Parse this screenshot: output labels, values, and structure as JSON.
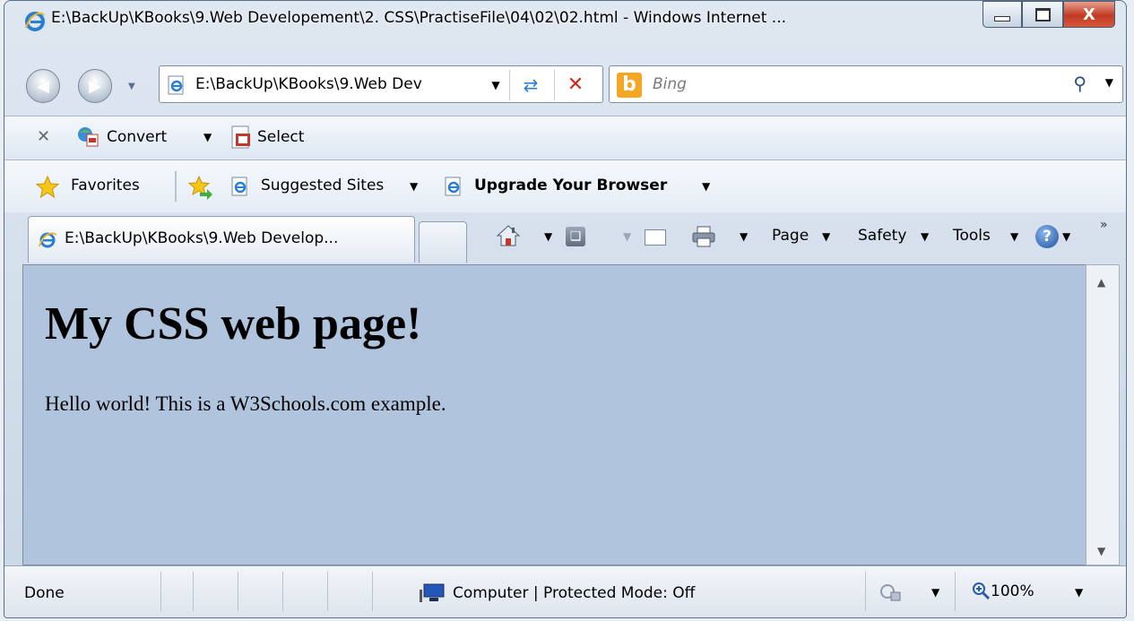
{
  "window": {
    "title": "E:\\BackUp\\KBooks\\9.Web Developement\\2. CSS\\PractiseFile\\04\\02\\02.html - Windows Internet ...",
    "close_glyph": "X"
  },
  "navigation": {
    "address": "E:\\BackUp\\KBooks\\9.Web Dev",
    "search_placeholder": "Bing",
    "search_logo": "b"
  },
  "command_bar": {
    "convert_label": "Convert",
    "select_label": "Select"
  },
  "favorites_bar": {
    "favorites_label": "Favorites",
    "suggested_sites_label": "Suggested Sites",
    "upgrade_label": "Upgrade Your Browser"
  },
  "tabs": [
    {
      "label": "E:\\BackUp\\KBooks\\9.Web Develop..."
    }
  ],
  "tools_bar": {
    "page_label": "Page",
    "safety_label": "Safety",
    "tools_label": "Tools",
    "help_glyph": "?"
  },
  "page": {
    "heading": "My CSS web page!",
    "paragraph": "Hello world! This is a W3Schools.com example.",
    "background_color": "#b0c4de"
  },
  "status_bar": {
    "status": "Done",
    "zone": "Computer | Protected Mode: Off",
    "zoom": "100%"
  },
  "icons": {
    "browser_logo": "internet-explorer-icon",
    "home": "home-icon",
    "feeds": "rss-feed-icon",
    "mail": "mail-icon",
    "print": "printer-icon",
    "help": "help-icon"
  }
}
